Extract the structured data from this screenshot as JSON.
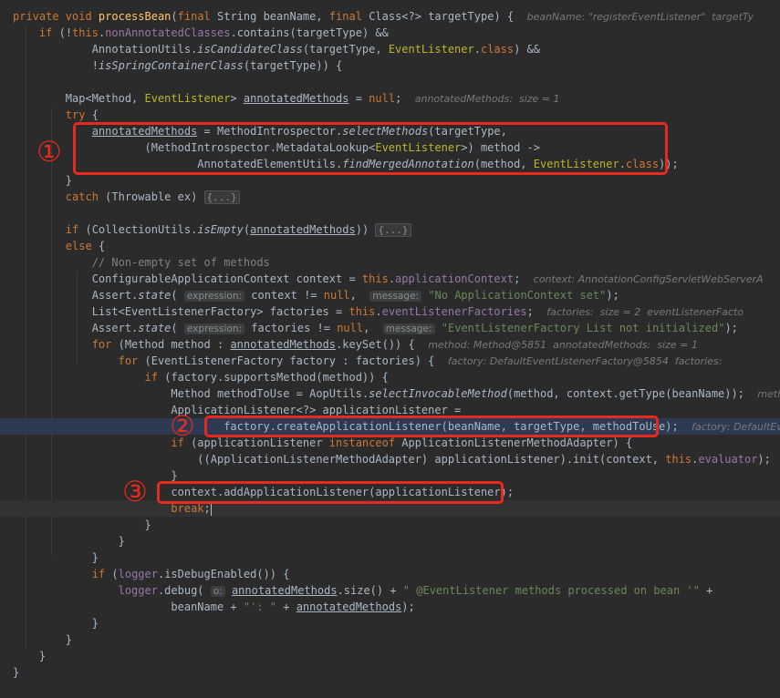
{
  "code_lines": [
    [
      {
        "t": "private void ",
        "c": "kw"
      },
      {
        "t": "processBean",
        "c": "fn"
      },
      {
        "t": "("
      },
      {
        "t": "final ",
        "c": "kw"
      },
      {
        "t": "String beanName, "
      },
      {
        "t": "final ",
        "c": "kw"
      },
      {
        "t": "Class<?> targetType) {  "
      },
      {
        "t": "beanName: \"registerEventListener\"  targetTy",
        "c": "hint"
      }
    ],
    [
      {
        "t": "    "
      },
      {
        "t": "if ",
        "c": "kw"
      },
      {
        "t": "(!"
      },
      {
        "t": "this",
        "c": "kw"
      },
      {
        "t": "."
      },
      {
        "t": "nonAnnotatedClasses",
        "c": "field"
      },
      {
        "t": ".contains(targetType) &&"
      }
    ],
    [
      {
        "t": "            AnnotationUtils."
      },
      {
        "t": "isCandidateClass",
        "c": "it"
      },
      {
        "t": "(targetType, "
      },
      {
        "t": "EventListener",
        "c": "type-hl"
      },
      {
        "t": "."
      },
      {
        "t": "class",
        "c": "kw"
      },
      {
        "t": ") &&"
      }
    ],
    [
      {
        "t": "            !"
      },
      {
        "t": "isSpringContainerClass",
        "c": "it"
      },
      {
        "t": "(targetType)) {"
      }
    ],
    [],
    [
      {
        "t": "        Map<Method, "
      },
      {
        "t": "EventListener",
        "c": "type-hl"
      },
      {
        "t": "> "
      },
      {
        "t": "annotatedMethods",
        "c": "ul"
      },
      {
        "t": " = "
      },
      {
        "t": "null",
        "c": "kw"
      },
      {
        "t": ";  "
      },
      {
        "t": "annotatedMethods:  size = 1",
        "c": "hint"
      }
    ],
    [
      {
        "t": "        "
      },
      {
        "t": "try ",
        "c": "kw"
      },
      {
        "t": "{"
      }
    ],
    [
      {
        "t": "            "
      },
      {
        "t": "annotatedMethods",
        "c": "ul"
      },
      {
        "t": " = MethodIntrospector."
      },
      {
        "t": "selectMethods",
        "c": "it"
      },
      {
        "t": "(targetType,"
      }
    ],
    [
      {
        "t": "                    (MethodIntrospector.MetadataLookup<"
      },
      {
        "t": "EventListener",
        "c": "type-hl"
      },
      {
        "t": ">) method ->"
      }
    ],
    [
      {
        "t": "                            AnnotatedElementUtils."
      },
      {
        "t": "findMergedAnnotation",
        "c": "it"
      },
      {
        "t": "(method, "
      },
      {
        "t": "EventListener",
        "c": "type-hl"
      },
      {
        "t": "."
      },
      {
        "t": "class",
        "c": "kw"
      },
      {
        "t": "));"
      }
    ],
    [
      {
        "t": "        }"
      }
    ],
    [
      {
        "t": "        "
      },
      {
        "t": "catch ",
        "c": "kw"
      },
      {
        "t": "(Throwable ex) "
      },
      {
        "t": "{...}",
        "c": "fold"
      }
    ],
    [],
    [
      {
        "t": "        "
      },
      {
        "t": "if ",
        "c": "kw"
      },
      {
        "t": "(CollectionUtils."
      },
      {
        "t": "isEmpty",
        "c": "it"
      },
      {
        "t": "("
      },
      {
        "t": "annotatedMethods",
        "c": "ul"
      },
      {
        "t": ")) "
      },
      {
        "t": "{...}",
        "c": "fold"
      }
    ],
    [
      {
        "t": "        "
      },
      {
        "t": "else ",
        "c": "kw"
      },
      {
        "t": "{"
      }
    ],
    [
      {
        "t": "            "
      },
      {
        "t": "// Non-empty set of methods",
        "c": "cm"
      }
    ],
    [
      {
        "t": "            ConfigurableApplicationContext context = "
      },
      {
        "t": "this",
        "c": "kw"
      },
      {
        "t": "."
      },
      {
        "t": "applicationContext",
        "c": "field"
      },
      {
        "t": ";  "
      },
      {
        "t": "context: AnnotationConfigServletWebServerA",
        "c": "hint"
      }
    ],
    [
      {
        "t": "            Assert."
      },
      {
        "t": "state",
        "c": "it"
      },
      {
        "t": "( "
      },
      {
        "t": "expression:",
        "c": "pill"
      },
      {
        "t": " context != "
      },
      {
        "t": "null",
        "c": "kw"
      },
      {
        "t": ",  "
      },
      {
        "t": "message:",
        "c": "pill"
      },
      {
        "t": " "
      },
      {
        "t": "\"No ApplicationContext set\"",
        "c": "str"
      },
      {
        "t": ");"
      }
    ],
    [
      {
        "t": "            List<EventListenerFactory> factories = "
      },
      {
        "t": "this",
        "c": "kw"
      },
      {
        "t": "."
      },
      {
        "t": "eventListenerFactories",
        "c": "field"
      },
      {
        "t": ";  "
      },
      {
        "t": "factories:  size = 2  eventListenerFacto",
        "c": "hint"
      }
    ],
    [
      {
        "t": "            Assert."
      },
      {
        "t": "state",
        "c": "it"
      },
      {
        "t": "( "
      },
      {
        "t": "expression:",
        "c": "pill"
      },
      {
        "t": " factories != "
      },
      {
        "t": "null",
        "c": "kw"
      },
      {
        "t": ",  "
      },
      {
        "t": "message:",
        "c": "pill"
      },
      {
        "t": " "
      },
      {
        "t": "\"EventListenerFactory List not initialized\"",
        "c": "str"
      },
      {
        "t": ");"
      }
    ],
    [
      {
        "t": "            "
      },
      {
        "t": "for ",
        "c": "kw"
      },
      {
        "t": "(Method method : "
      },
      {
        "t": "annotatedMethods",
        "c": "ul"
      },
      {
        "t": ".keySet()) {  "
      },
      {
        "t": "method: Method@5851  annotatedMethods:  size = 1",
        "c": "hint"
      }
    ],
    [
      {
        "t": "                "
      },
      {
        "t": "for ",
        "c": "kw"
      },
      {
        "t": "(EventListenerFactory factory : factories) {  "
      },
      {
        "t": "factory: DefaultEventListenerFactory@5854  factories:",
        "c": "hint"
      }
    ],
    [
      {
        "t": "                    "
      },
      {
        "t": "if ",
        "c": "kw"
      },
      {
        "t": "(factory.supportsMethod(method)) {"
      }
    ],
    [
      {
        "t": "                        Method methodToUse = AopUtils."
      },
      {
        "t": "selectInvocableMethod",
        "c": "it"
      },
      {
        "t": "(method, context.getType(beanName));  "
      },
      {
        "t": "methodTo",
        "c": "hint"
      }
    ],
    [
      {
        "t": "                        ApplicationListener<?> applicationListener ="
      }
    ],
    [
      {
        "t": "                                factory.createApplicationListener(beanName, targetType, methodToUse);  "
      },
      {
        "t": "factory: DefaultEv",
        "c": "hint"
      }
    ],
    [
      {
        "t": "                        "
      },
      {
        "t": "if ",
        "c": "kw"
      },
      {
        "t": "(applicationListener "
      },
      {
        "t": "instanceof ",
        "c": "kw"
      },
      {
        "t": "ApplicationListenerMethodAdapter) {"
      }
    ],
    [
      {
        "t": "                            ((ApplicationListenerMethodAdapter) applicationListener).init(context, "
      },
      {
        "t": "this",
        "c": "kw"
      },
      {
        "t": "."
      },
      {
        "t": "evaluator",
        "c": "field"
      },
      {
        "t": ");"
      }
    ],
    [
      {
        "t": "                        }"
      }
    ],
    [
      {
        "t": "                        context.addApplicationListener(applicationListener);"
      }
    ],
    [
      {
        "t": "                        "
      },
      {
        "t": "break",
        "c": "kw"
      },
      {
        "t": ";"
      }
    ],
    [
      {
        "t": "                    }"
      }
    ],
    [
      {
        "t": "                }"
      }
    ],
    [
      {
        "t": "            }"
      }
    ],
    [
      {
        "t": "            "
      },
      {
        "t": "if ",
        "c": "kw"
      },
      {
        "t": "("
      },
      {
        "t": "logger",
        "c": "field"
      },
      {
        "t": ".isDebugEnabled()) {"
      }
    ],
    [
      {
        "t": "                "
      },
      {
        "t": "logger",
        "c": "field"
      },
      {
        "t": ".debug( "
      },
      {
        "t": "o:",
        "c": "pill"
      },
      {
        "t": " "
      },
      {
        "t": "annotatedMethods",
        "c": "ul"
      },
      {
        "t": ".size() + "
      },
      {
        "t": "\" @EventListener methods processed on bean '\"",
        "c": "str"
      },
      {
        "t": " +"
      }
    ],
    [
      {
        "t": "                        beanName + "
      },
      {
        "t": "\"': \"",
        "c": "str"
      },
      {
        "t": " + "
      },
      {
        "t": "annotatedMethods",
        "c": "ul"
      },
      {
        "t": ");"
      }
    ],
    [
      {
        "t": "            }"
      }
    ],
    [
      {
        "t": "        }"
      }
    ],
    [
      {
        "t": "    }"
      }
    ],
    [
      {
        "t": "}"
      }
    ]
  ],
  "annotations": {
    "marker_1": "①",
    "marker_2": "②",
    "marker_3": "③"
  },
  "colors": {
    "background": "#2b2b2b",
    "text": "#a9b7c6",
    "keyword": "#cc7832",
    "method_decl": "#ffc66d",
    "field": "#9876aa",
    "highlighted_type": "#bbb529",
    "string": "#6a8759",
    "comment": "#808080",
    "execution_line": "#2d3b52",
    "annotation_red": "#e62a20"
  }
}
